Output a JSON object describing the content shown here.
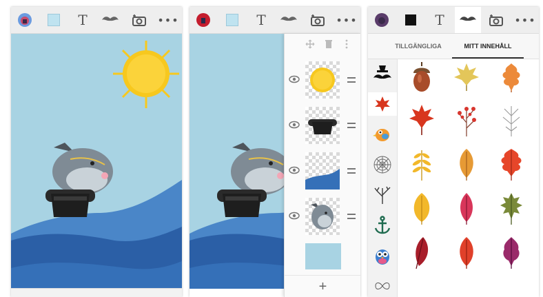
{
  "screens": [
    {
      "toolbar_icons": [
        "avatar-icon",
        "color-swatch-icon",
        "text-tool-icon",
        "mustache-icon",
        "camera-icon",
        "more-icon"
      ],
      "text_tool_label": "T",
      "more_label": "•••"
    },
    {
      "toolbar_icons": [
        "avatar-icon",
        "color-swatch-icon",
        "text-tool-icon",
        "mustache-icon",
        "camera-icon",
        "more-icon"
      ],
      "text_tool_label": "T",
      "more_label": "•••",
      "layers_panel": {
        "header_icons": [
          "move-icon",
          "trash-icon",
          "more-vertical-icon"
        ],
        "layers": [
          "sun",
          "top-hat",
          "waves",
          "shark",
          "background"
        ],
        "add_label": "+"
      }
    },
    {
      "toolbar_icons": [
        "avatar-icon",
        "color-swatch-icon",
        "text-tool-icon",
        "mustache-icon",
        "camera-icon",
        "more-icon"
      ],
      "text_tool_label": "T",
      "more_label": "•••",
      "tabs": [
        {
          "label": "TILLGÄNGLIGA",
          "active": false
        },
        {
          "label": "MITT INNEHÅLL",
          "active": true
        }
      ],
      "categories": [
        "mustache",
        "maple-leaf",
        "bird",
        "spiderweb",
        "tree",
        "anchor",
        "owl",
        "ornament"
      ],
      "stickers": [
        "acorn",
        "yellow-maple-leaf",
        "orange-oak-leaf",
        "red-maple-leaf",
        "berry-branch",
        "bare-branch",
        "yellow-fern-leaf",
        "orange-leaf",
        "red-oak-leaf",
        "yellow-leaf",
        "pink-leaf",
        "green-oak-leaf",
        "crimson-leaf",
        "red-leaf",
        "purple-leaf"
      ]
    }
  ],
  "colors": {
    "sky": "#a8d3e3",
    "sea_dark": "#2b5fa6",
    "sea_light": "#4a86c8",
    "sun": "#f7c81e",
    "toolbar_bg": "#eeeeee"
  }
}
